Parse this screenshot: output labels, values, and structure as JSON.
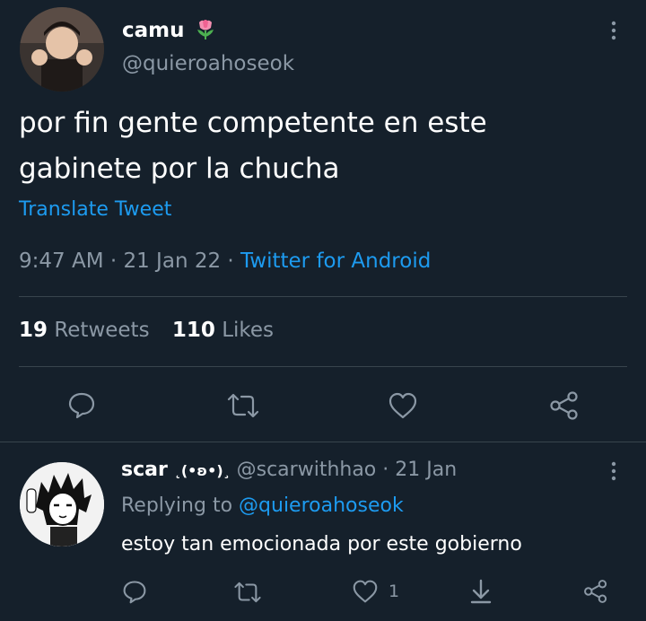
{
  "tweet": {
    "display_name": "camu",
    "name_emoji": "tulip-emoji",
    "handle": "@quieroahoseok",
    "text_line1": "por fin gente competente en este",
    "text_line2": "gabinete por la chucha",
    "translate_label": "Translate Tweet",
    "time": "9:47 AM",
    "sep1": "·",
    "date": "21 Jan 22",
    "sep2": "·",
    "source": "Twitter for Android",
    "retweets_count": "19",
    "retweets_label": "Retweets",
    "likes_count": "110",
    "likes_label": "Likes"
  },
  "reply": {
    "display_name": "scar",
    "name_kaomoji": "˛(•ʚ•)¸",
    "handle": "@scarwithhao",
    "sep": "·",
    "date": "21 Jan",
    "replying_prefix": "Replying to",
    "replying_handle": "@quieroahoseok",
    "text": "estoy tan emocionada por este gobierno",
    "like_count": "1"
  },
  "colors": {
    "background": "#15202b",
    "text": "#ffffff",
    "muted": "#8b98a5",
    "link": "#1d9bf0",
    "divider": "#38444d"
  }
}
